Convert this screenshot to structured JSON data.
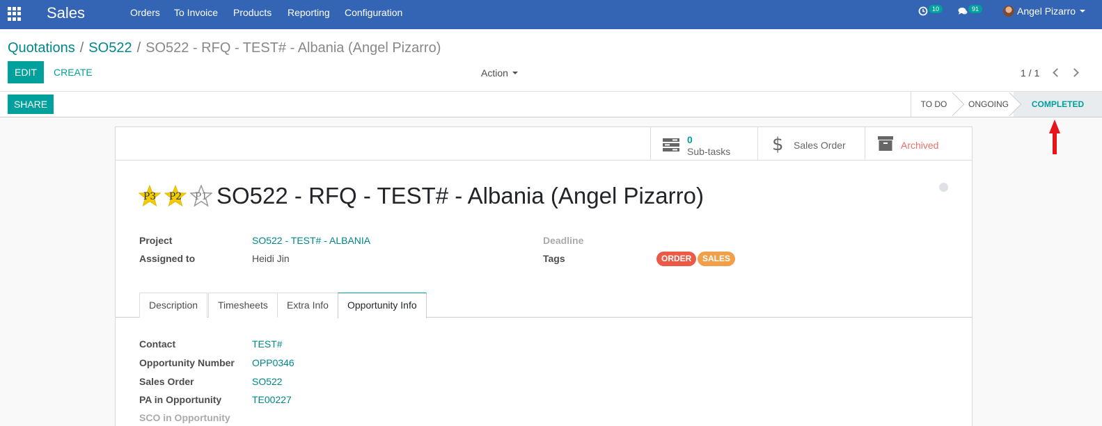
{
  "navbar": {
    "app_name": "Sales",
    "menu": [
      "Orders",
      "To Invoice",
      "Products",
      "Reporting",
      "Configuration"
    ],
    "activity_count": "10",
    "messages_count": "91",
    "user_name": "Angel Pizarro",
    "bg_color": "#3465b5"
  },
  "breadcrumb": {
    "items": [
      "Quotations",
      "SO522"
    ],
    "current": "SO522 - RFQ - TEST# - Albania (Angel Pizarro)"
  },
  "toolbar": {
    "edit_label": "EDIT",
    "create_label": "CREATE",
    "action_label": "Action",
    "pager": "1 / 1"
  },
  "statusbar": {
    "share_label": "SHARE",
    "stages": [
      "TO DO",
      "ONGOING",
      "COMPLETED"
    ],
    "active_stage": "COMPLETED"
  },
  "smart_buttons": {
    "subtasks_count": "0",
    "subtasks_label": "Sub-tasks",
    "sales_order_label": "Sales Order",
    "archived_label": "Archived"
  },
  "record": {
    "priority_stars": [
      {
        "label": "P3",
        "filled": true
      },
      {
        "label": "P2",
        "filled": true
      },
      {
        "label": "P1",
        "filled": false
      }
    ],
    "title": "SO522 - RFQ - TEST# - Albania (Angel Pizarro)",
    "fields_left": [
      {
        "label": "Project",
        "value": "SO522 - TEST# - ALBANIA",
        "link": true
      },
      {
        "label": "Assigned to",
        "value": "Heidi Jin",
        "link": false
      }
    ],
    "deadline_label": "Deadline",
    "tags_label": "Tags",
    "tags": [
      {
        "label": "ORDER",
        "color": "#eb5a46"
      },
      {
        "label": "SALES",
        "color": "#f0a04b"
      }
    ]
  },
  "tabs": [
    "Description",
    "Timesheets",
    "Extra Info",
    "Opportunity Info"
  ],
  "active_tab": "Opportunity Info",
  "opportunity_info": [
    {
      "label": "Contact",
      "value": "TEST#"
    },
    {
      "label": "Opportunity Number",
      "value": "OPP0346"
    },
    {
      "label": "Sales Order",
      "value": "SO522"
    },
    {
      "label": "PA in Opportunity",
      "value": "TE00227"
    },
    {
      "label": "SCO in Opportunity",
      "value": ""
    }
  ],
  "accent_color": "#00a09d",
  "annotation_color": "#e8141b"
}
